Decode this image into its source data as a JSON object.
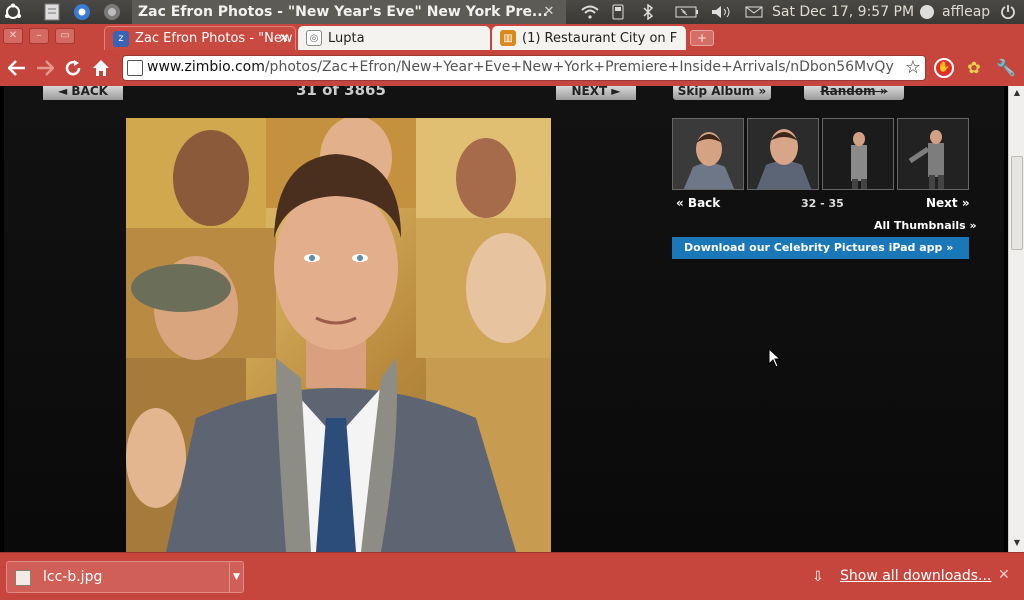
{
  "system_panel": {
    "window_title": "Zac Efron Photos - \"New Year's Eve\" New York Pre...",
    "clock": "Sat Dec 17,  9:57 PM",
    "user": "affleap"
  },
  "tabs": [
    {
      "label": "Zac Efron Photos - \"New",
      "active": true
    },
    {
      "label": "Lupta",
      "active": false
    },
    {
      "label": "(1) Restaurant City on F",
      "active": false
    }
  ],
  "toolbar": {
    "url_host": "www.zimbio.com",
    "url_path": "/photos/Zac+Efron/New+Year+Eve+New+York+Premiere+Inside+Arrivals/nDbon56MvQy"
  },
  "page": {
    "back_label": "◄ BACK",
    "next_label": "NEXT ►",
    "counter": "31 of 3865",
    "skip_album": "Skip Album »",
    "random": "Random »",
    "thumbs_back": "« Back",
    "thumbs_range": "32 - 35",
    "thumbs_next": "Next »",
    "all_thumbnails": "All Thumbnails »",
    "ipad_banner": "Download our Celebrity Pictures iPad app »"
  },
  "downloads": {
    "file_name": "lcc-b.jpg",
    "show_all": "Show all downloads..."
  },
  "colors": {
    "chrome_red": "#c6463d",
    "banner_blue": "#1b78b8",
    "panel_dark": "#3a3935"
  }
}
